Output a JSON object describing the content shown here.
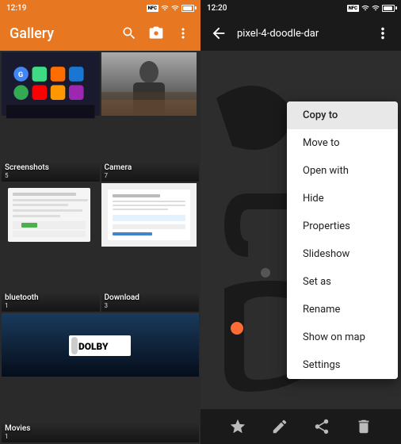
{
  "left": {
    "status_bar": {
      "time": "12:19",
      "nfc": "NFC",
      "icons": [
        "signal",
        "wifi",
        "battery"
      ]
    },
    "header": {
      "title": "Gallery",
      "icons": [
        "search",
        "camera",
        "more-vert"
      ]
    },
    "items": [
      {
        "name": "Screenshots",
        "count": "5",
        "thumb": "screenshots"
      },
      {
        "name": "Camera",
        "count": "7",
        "thumb": "camera"
      },
      {
        "name": "bluetooth",
        "count": "1",
        "thumb": "bluetooth"
      },
      {
        "name": "Download",
        "count": "3",
        "thumb": "download"
      },
      {
        "name": "Movies",
        "count": "1",
        "thumb": "movies"
      }
    ]
  },
  "right": {
    "status_bar": {
      "time": "12:20",
      "nfc": "NFC",
      "icons": [
        "signal",
        "wifi",
        "battery"
      ]
    },
    "header": {
      "back_icon": "←",
      "title": "pixel-4-doodle-dar",
      "more_icon": "⋮"
    },
    "context_menu": {
      "items": [
        {
          "label": "Copy to",
          "highlighted": true
        },
        {
          "label": "Move to"
        },
        {
          "label": "Open with"
        },
        {
          "label": "Hide"
        },
        {
          "label": "Properties"
        },
        {
          "label": "Slideshow"
        },
        {
          "label": "Set as"
        },
        {
          "label": "Rename"
        },
        {
          "label": "Show on map"
        },
        {
          "label": "Settings"
        }
      ]
    },
    "bottom_bar": {
      "icons": [
        "star",
        "edit",
        "share",
        "delete"
      ]
    }
  }
}
